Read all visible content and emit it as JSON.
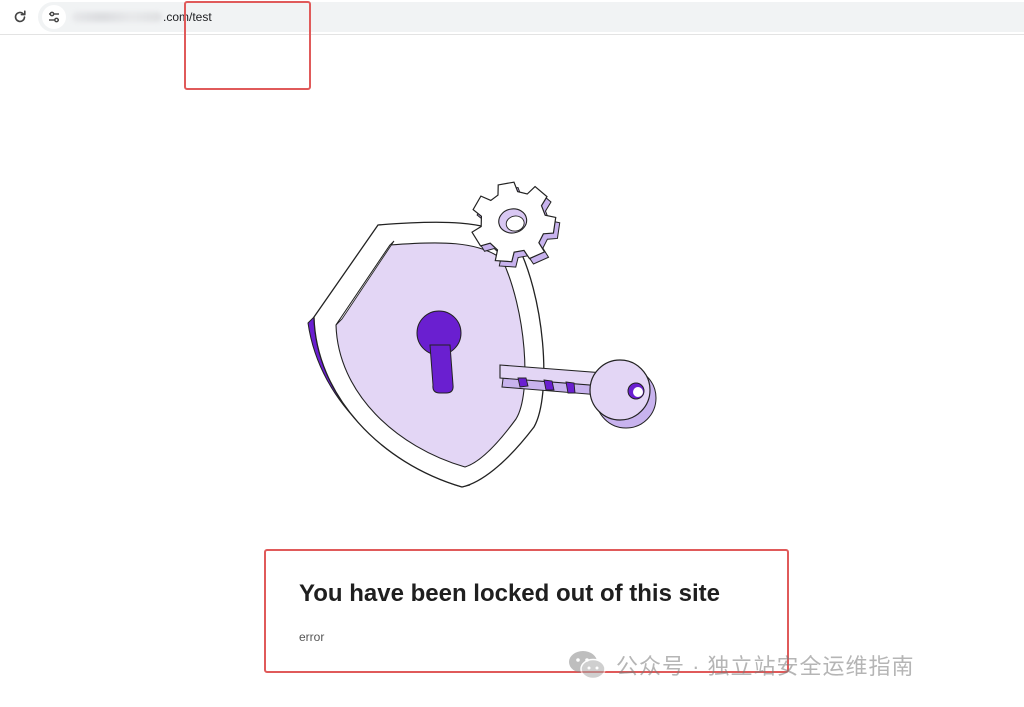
{
  "browser": {
    "url_visible": ".com/test",
    "reload_icon": "reload-icon",
    "site_info_icon": "tune-icon"
  },
  "illustration": {
    "icons": [
      "shield-icon",
      "keyhole-icon",
      "gear-icon",
      "key-icon"
    ],
    "colors": {
      "light_purple": "#e3d6f5",
      "dark_purple": "#6a1fd0",
      "outline": "#222222"
    }
  },
  "message": {
    "title": "You have been locked out of this site",
    "code": "error"
  },
  "annotations": {
    "color": "#e05a5a"
  },
  "watermark": {
    "text": "公众号 · 独立站安全运维指南",
    "icon": "wechat-icon"
  }
}
